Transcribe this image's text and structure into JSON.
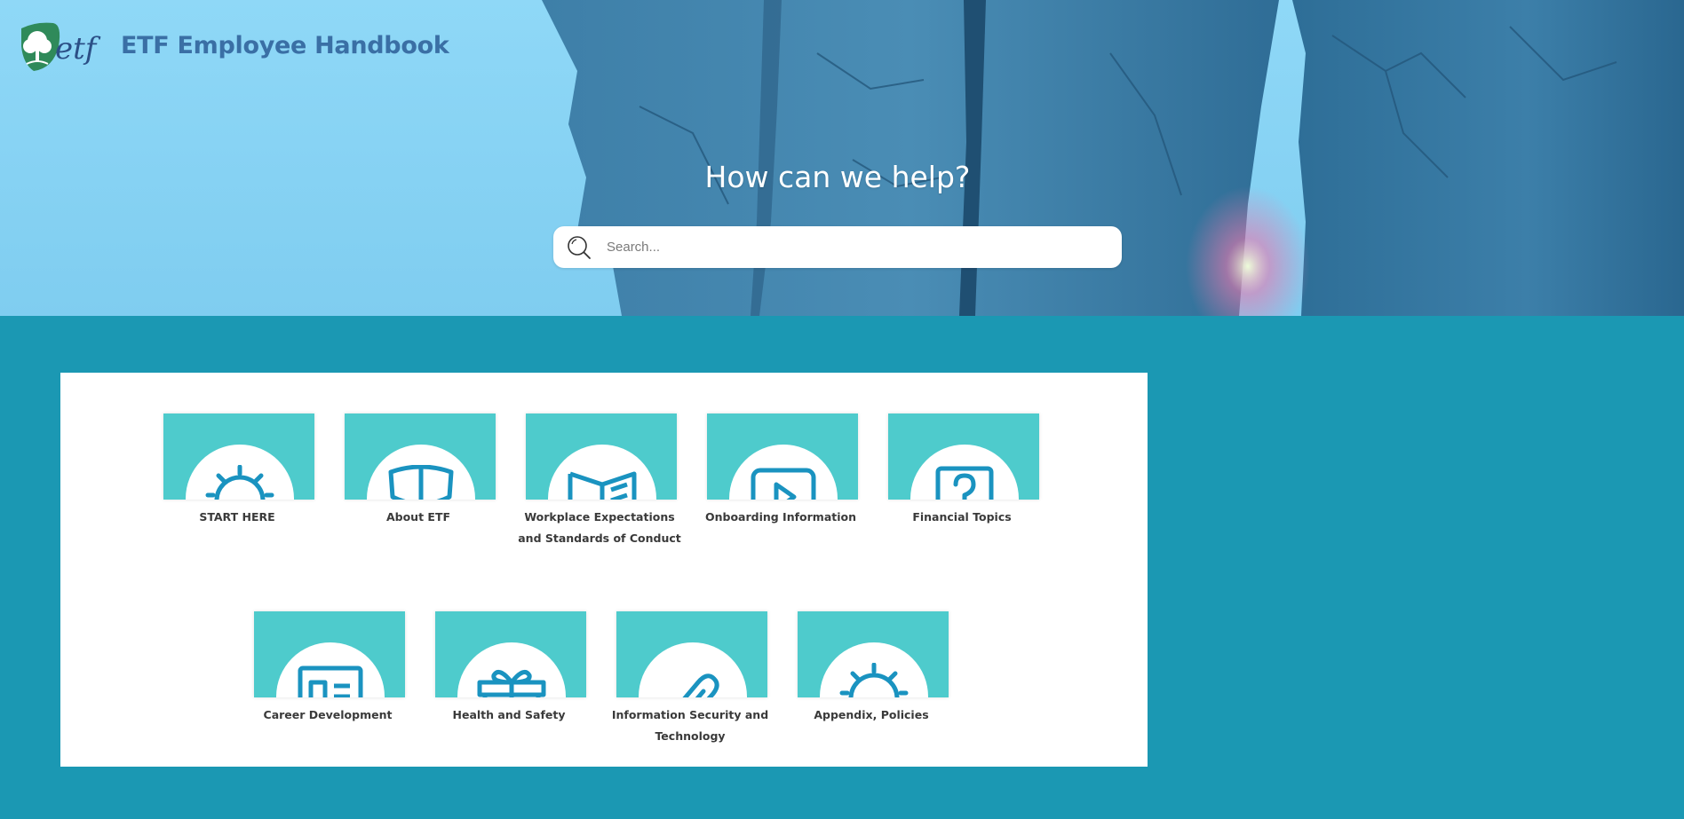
{
  "header": {
    "site_title": "ETF Employee Handbook",
    "logo_icon": "etf-tree-logo"
  },
  "hero": {
    "heading": "How can we help?",
    "search": {
      "placeholder": "Search...",
      "value": "",
      "icon": "search-icon"
    }
  },
  "colors": {
    "page_bg": "#1b98b3",
    "tile_bg": "#4ecbcc",
    "icon_blue": "#1a93c0",
    "title_blue": "#3a6fa5"
  },
  "categories": [
    {
      "label": "START HERE",
      "icon": "sunrise-icon"
    },
    {
      "label": "About ETF",
      "icon": "shield-icon"
    },
    {
      "label": "Workplace Expectations and Standards of Conduct",
      "icon": "open-book-icon"
    },
    {
      "label": "Onboarding Information",
      "icon": "play-video-icon"
    },
    {
      "label": "Financial Topics",
      "icon": "question-icon"
    },
    {
      "label": "Career Development",
      "icon": "id-card-icon"
    },
    {
      "label": "Health and Safety",
      "icon": "gift-icon"
    },
    {
      "label": "Information Security and Technology",
      "icon": "paperclip-icon"
    },
    {
      "label": "Appendix, Policies",
      "icon": "sunrise-icon"
    }
  ]
}
